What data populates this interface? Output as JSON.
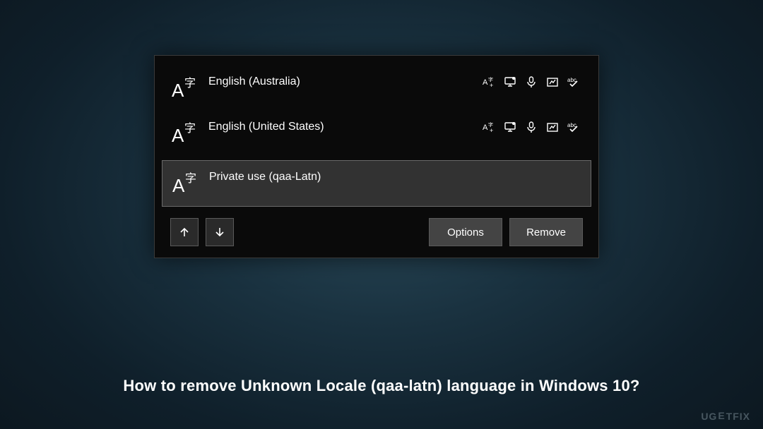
{
  "languages": [
    {
      "name": "English (Australia)",
      "hasFeatures": true,
      "selected": false
    },
    {
      "name": "English (United States)",
      "hasFeatures": true,
      "selected": false
    },
    {
      "name": "Private use (qaa-Latn)",
      "hasFeatures": false,
      "selected": true
    }
  ],
  "buttons": {
    "options": "Options",
    "remove": "Remove"
  },
  "caption": "How to remove Unknown Locale (qaa-latn) language in Windows 10?",
  "watermark": {
    "part1": "UG",
    "part2": "E",
    "part3": "TFIX"
  }
}
